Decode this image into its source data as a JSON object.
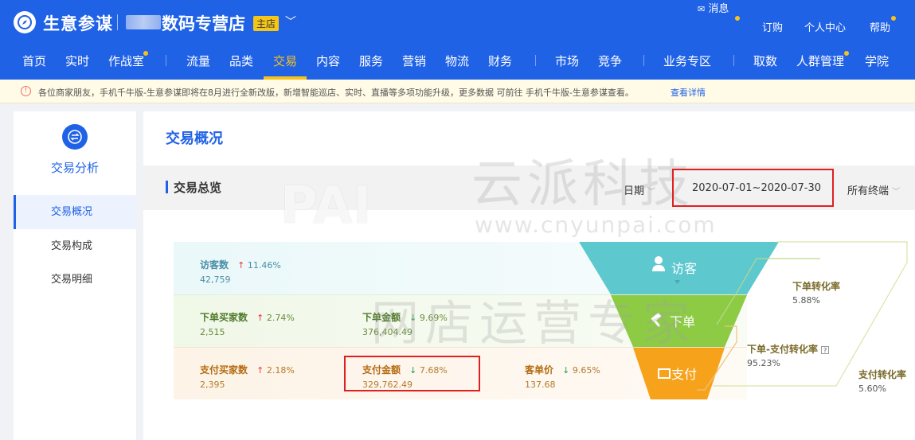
{
  "header": {
    "brand": "生意参谋",
    "shop_name": "数码专营店",
    "shop_badge": "主店",
    "links": {
      "messages": "消息",
      "subscribe": "订购",
      "profile": "个人中心",
      "help": "帮助"
    },
    "nav": [
      "首页",
      "实时",
      "作战室",
      "流量",
      "品类",
      "交易",
      "内容",
      "服务",
      "营销",
      "物流",
      "财务",
      "市场",
      "竞争",
      "业务专区",
      "取数",
      "人群管理",
      "学院"
    ],
    "active_nav": "交易"
  },
  "notice": {
    "text": "各位商家朋友，手机千牛版-生意参谋即将在8月进行全新改版，新增智能巡店、实时、直播等多项功能升级，更多数据 可前往 手机千牛版-生意参谋查看。",
    "link": "查看详情"
  },
  "sidebar": {
    "title": "交易分析",
    "items": [
      {
        "label": "交易概况"
      },
      {
        "label": "交易构成"
      },
      {
        "label": "交易明细"
      }
    ]
  },
  "main": {
    "page_title": "交易概况",
    "section_title": "交易总览",
    "date_label": "日期",
    "date_range": "2020-07-01~2020-07-30",
    "terminal": "所有终端"
  },
  "metrics": {
    "visitors": {
      "label": "访客数",
      "trend": "11.46%",
      "direction": "up",
      "value": "42,759"
    },
    "order_buyers": {
      "label": "下单买家数",
      "trend": "2.74%",
      "direction": "up",
      "value": "2,515"
    },
    "order_amount": {
      "label": "下单金额",
      "trend": "9.69%",
      "direction": "down",
      "value": "376,404.49"
    },
    "pay_buyers": {
      "label": "支付买家数",
      "trend": "2.18%",
      "direction": "up",
      "value": "2,395"
    },
    "pay_amount": {
      "label": "支付金额",
      "trend": "7.68%",
      "direction": "down",
      "value": "329,762.49"
    },
    "unit_price": {
      "label": "客单价",
      "trend": "9.65%",
      "direction": "down",
      "value": "137.68"
    }
  },
  "funnel": {
    "stages": [
      "访客",
      "下单",
      "支付"
    ],
    "rates": {
      "order_rate": {
        "label": "下单转化率",
        "value": "5.88%"
      },
      "order_pay_rate": {
        "label": "下单-支付转化率",
        "value": "95.23%"
      },
      "pay_rate": {
        "label": "支付转化率",
        "value": "5.60%"
      }
    },
    "colors": {
      "visit": "#5ec8cf",
      "order": "#8dcb45",
      "pay": "#f7a21b"
    }
  },
  "watermark": {
    "logo": "PAI",
    "company": "云派科技",
    "url": "www.cnyunpai.com",
    "slogan": "网店运营专家"
  }
}
